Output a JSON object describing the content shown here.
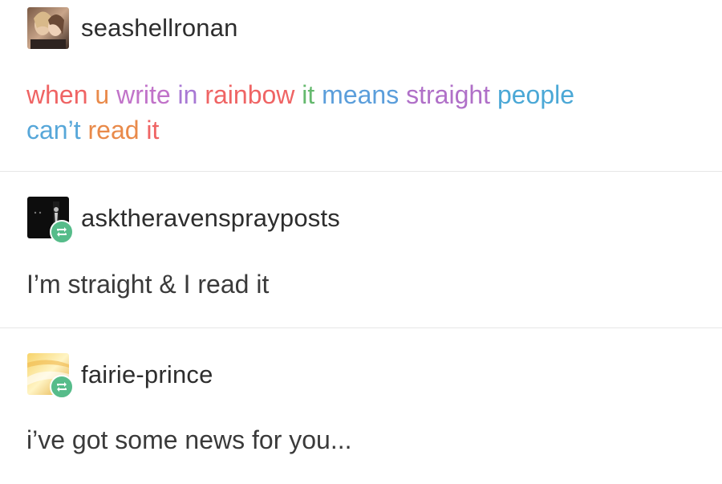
{
  "posts": [
    {
      "username": "seashellronan",
      "rainbow_lines": [
        [
          {
            "text": "when",
            "color": "#ef6464"
          },
          {
            "text": " "
          },
          {
            "text": "u",
            "color": "#e98a4a"
          },
          {
            "text": " "
          },
          {
            "text": "write",
            "color": "#c173c9"
          },
          {
            "text": " "
          },
          {
            "text": "in",
            "color": "#a878d4"
          },
          {
            "text": " "
          },
          {
            "text": "rainbow",
            "color": "#ef6464"
          },
          {
            "text": " "
          },
          {
            "text": "it",
            "color": "#65b96e"
          },
          {
            "text": " "
          },
          {
            "text": "means",
            "color": "#5b9edb"
          },
          {
            "text": " "
          },
          {
            "text": "straight",
            "color": "#b070c8"
          },
          {
            "text": " "
          },
          {
            "text": "people",
            "color": "#4ba8d6"
          }
        ],
        [
          {
            "text": "can’t",
            "color": "#57a7d9"
          },
          {
            "text": " "
          },
          {
            "text": "read",
            "color": "#e98a4a"
          },
          {
            "text": " "
          },
          {
            "text": "it",
            "color": "#ef6464"
          }
        ]
      ]
    },
    {
      "username": "asktheravensprayposts",
      "text": "I’m straight & I read it"
    },
    {
      "username": "fairie-prince",
      "text": "i’ve got some news for you..."
    }
  ],
  "colors": {
    "reblog_badge": "#56bc8a",
    "divider": "#e6e6e6"
  }
}
